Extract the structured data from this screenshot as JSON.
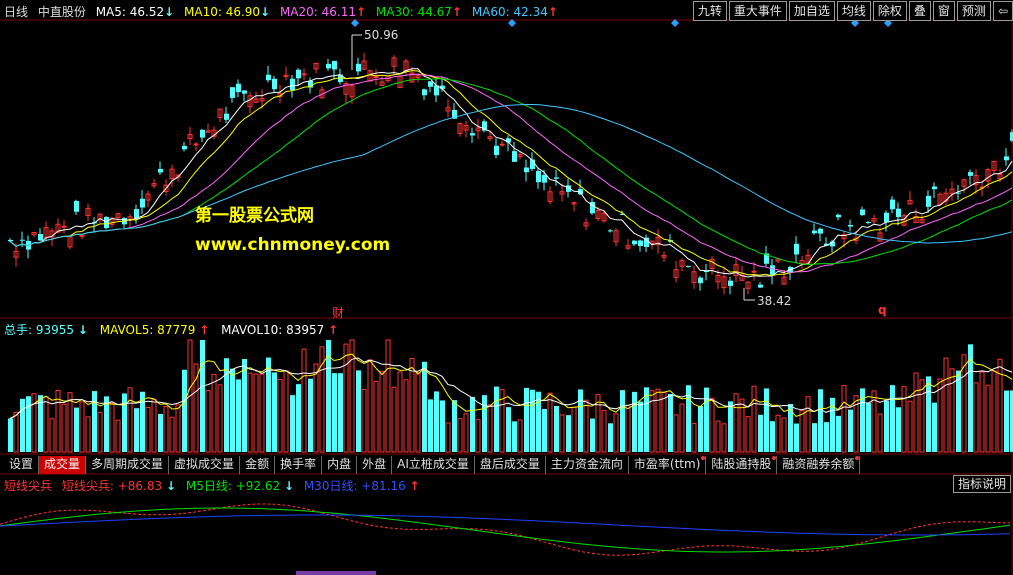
{
  "header": {
    "period": "日线",
    "stock_name": "中直股份",
    "ma5": "MA5: 46.52",
    "ma10": "MA10: 46.90",
    "ma20": "MA20: 46.11",
    "ma30": "MA30: 44.67",
    "ma60": "MA60: 42.34",
    "ma5_arrow": "↓",
    "ma10_arrow": "↓",
    "ma20_arrow": "↑",
    "ma30_arrow": "↑",
    "ma60_arrow": "↑"
  },
  "toolbar": {
    "nine_turn": "九转",
    "major_events": "重大事件",
    "add_watch": "加自选",
    "ma_line": "均线",
    "ex_right": "除权",
    "overlay": "叠",
    "window": "窗",
    "forecast": "预测",
    "back_icon": "⇦"
  },
  "main_chart": {
    "high_label": "50.96",
    "low_label": "38.42",
    "marker_cai": "财",
    "marker_q": "q"
  },
  "watermark": {
    "line1": "第一股票公式网",
    "line2": "www.chnmoney.com"
  },
  "volume_header": {
    "total": "总手: 93955",
    "total_arrow": "↓",
    "mavol5": "MAVOL5: 87779",
    "mavol5_arrow": "↑",
    "mavol10": "MAVOL10: 83957",
    "mavol10_arrow": "↑"
  },
  "tabs": [
    "设置",
    "成交量",
    "多周期成交量",
    "虚拟成交量",
    "金额",
    "换手率",
    "内盘",
    "外盘",
    "AI立桩成交量",
    "盘后成交量",
    "主力资金流向",
    "市盈率(ttm)",
    "陆股通持股",
    "融资融券余额"
  ],
  "indicator_header": {
    "name": "短线尖兵",
    "line1": "短线尖兵: +86.83",
    "line1_arrow": "↓",
    "line2": "M5日线: +92.62",
    "line2_arrow": "↓",
    "line3": "M30日线: +81.16",
    "line3_arrow": "↑",
    "help": "指标说明"
  },
  "colors": {
    "up": "#ff3333",
    "down": "#54ffff",
    "ma5": "#ffffff",
    "ma10": "#ffff00",
    "ma20": "#ff66ff",
    "ma30": "#00e000",
    "ma60": "#40c8ff",
    "grid": "#7a0000"
  }
}
